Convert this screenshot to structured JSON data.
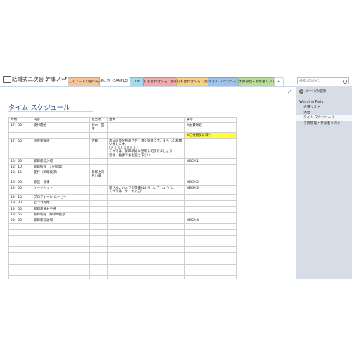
{
  "notebook": {
    "title": "結婚式二次会 幹事ノート"
  },
  "tabs": [
    {
      "label": "このノートの使い方",
      "color": "#f5c69b"
    },
    {
      "label": "使い方（SAMPLE）",
      "color": "#c6c6c6"
    },
    {
      "label": "TOP",
      "color": "#a6d9ec"
    },
    {
      "label": "打ち合わせメモ（会場）",
      "color": "#f2a9a9"
    },
    {
      "label": "打ち合わせメモ（演出）",
      "color": "#f6cf84"
    },
    {
      "label": "タイム スケジュール",
      "color": "#9ec3ea"
    },
    {
      "label": "予算管理・参加者リスト",
      "color": "#b7dd96"
    },
    {
      "label": "+",
      "color": "#ffffff"
    }
  ],
  "search": {
    "placeholder": "検索 (Ctrl+E)"
  },
  "page": {
    "title": "タイム スケジュール"
  },
  "table": {
    "headers": [
      "時間",
      "内容",
      "担当者",
      "台本",
      "備考"
    ],
    "rows": [
      [
        "17：30～",
        "受付開始",
        "鈴木・田中",
        "",
        "※会費徴収"
      ],
      [
        "",
        "",
        "",
        "",
        "※ご祝儀受け取り"
      ],
      [
        "17：55",
        "司会者挨拶",
        "佐藤",
        "本日司会を務めさせて頂く佐藤です。よろしくお願い致します。\n〇〇〇〇〇〇〇〇〇\nそれでは、新郎新婦に登場して頂きましょう\n皆様、拍手でお出迎え下さい！",
        ""
      ],
      [
        "18：00",
        "新郎新婦入場",
        "",
        "",
        "※BGM1"
      ],
      [
        "18：10",
        "新郎挨拶（3分程度）",
        "",
        "",
        ""
      ],
      [
        "18：15",
        "乾杯（新郎挨拶）",
        "新郎上司\n石川様",
        "",
        ""
      ],
      [
        "18：20",
        "歓談・食事",
        "",
        "",
        "※BGM2"
      ],
      [
        "19：00",
        "ケーキカット",
        "",
        "新さん、カメラの準備はよろしいでしょうか。\nそれでは、ケーキ入刀！",
        "※BGM3"
      ],
      [
        "19：15",
        "プロフィール ムービー",
        "",
        "",
        ""
      ],
      [
        "19：30",
        "ビンゴ開始",
        "",
        "",
        ""
      ],
      [
        "19：50",
        "新郎新婦お手紙",
        "",
        "",
        ""
      ],
      [
        "19：55",
        "新郎新婦　締めの挨拶",
        "",
        "",
        ""
      ],
      [
        "20：00",
        "新郎新婦退場",
        "",
        "",
        "※BGM4"
      ],
      [
        "",
        "",
        "",
        "",
        ""
      ],
      [
        "",
        "",
        "",
        "",
        ""
      ],
      [
        "",
        "",
        "",
        "",
        ""
      ],
      [
        "",
        "",
        "",
        "",
        ""
      ],
      [
        "",
        "",
        "",
        "",
        ""
      ],
      [
        "",
        "",
        "",
        "",
        ""
      ],
      [
        "",
        "",
        "",
        "",
        ""
      ],
      [
        "",
        "",
        "",
        "",
        ""
      ],
      [
        "",
        "",
        "",
        "",
        ""
      ],
      [
        "",
        "",
        "",
        "",
        ""
      ]
    ]
  },
  "sidebar": {
    "add_page": "ページの追加",
    "items": [
      {
        "label": "Wedding Party",
        "sub": false
      },
      {
        "label": "会場リスト",
        "sub": true
      },
      {
        "label": "演出",
        "sub": true
      },
      {
        "label": "タイム スケジュール",
        "sub": true,
        "selected": true
      },
      {
        "label": "予算管理・参加者リスト",
        "sub": true
      }
    ]
  }
}
